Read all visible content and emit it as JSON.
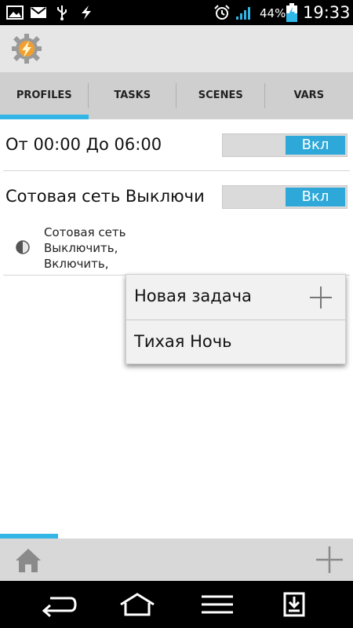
{
  "status_bar": {
    "battery_percent": "44%",
    "time": "19:33",
    "icons": [
      "image-icon",
      "mail-icon",
      "usb-icon",
      "bolt-icon",
      "alarm-icon",
      "signal-icon",
      "battery-charging-icon"
    ]
  },
  "app": {
    "logo_icon": "tasker-gear-lightning-icon"
  },
  "tabs": [
    {
      "label": "PROFILES",
      "active": true
    },
    {
      "label": "TASKS",
      "active": false
    },
    {
      "label": "SCENES",
      "active": false
    },
    {
      "label": "VARS",
      "active": false
    }
  ],
  "profiles": [
    {
      "title": "От 00:00 До 06:00",
      "toggle_label": "Вкл"
    },
    {
      "title": "Сотовая сеть Выключи",
      "toggle_label": "Вкл"
    }
  ],
  "task_detail": {
    "icon": "half-circle-icon",
    "lines": [
      "Сотовая сеть",
      "Выключить,",
      "Включить,"
    ]
  },
  "popup_menu": {
    "items": [
      {
        "label": "Новая задача",
        "icon": "plus-icon"
      },
      {
        "label": "Тихая Ночь"
      }
    ]
  },
  "bottom_bar": {
    "home_icon": "home-icon",
    "add_icon": "plus-icon",
    "progress_fraction": 0.165
  },
  "nav_bar": {
    "icons": [
      "back-icon",
      "home-outline-icon",
      "menu-icon",
      "download-box-icon"
    ]
  },
  "colors": {
    "accent": "#33b5e5",
    "toggle_on": "#2ea8d8",
    "tab_bg": "#cfcfcf",
    "appbar_bg": "#e6e6e6"
  }
}
